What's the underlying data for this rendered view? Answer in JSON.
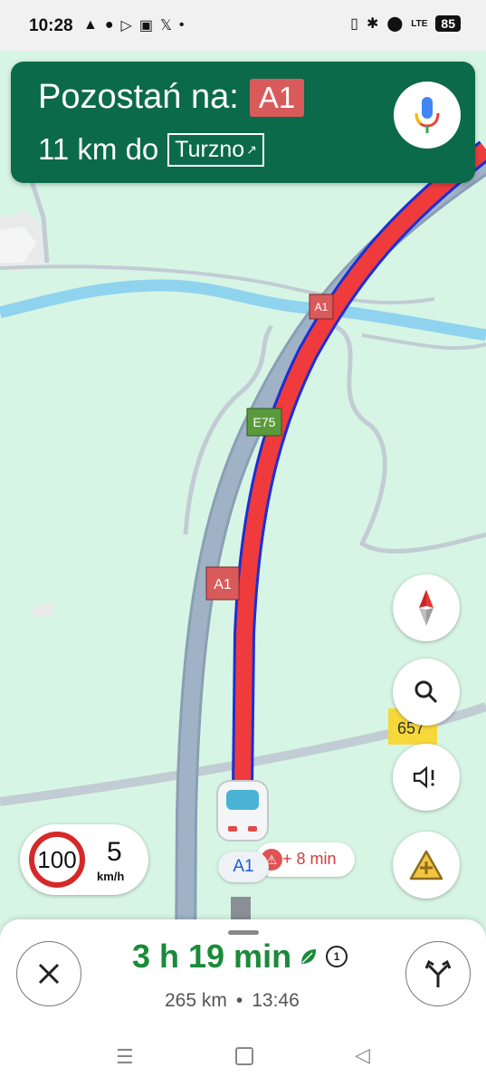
{
  "status_bar": {
    "time": "10:28",
    "battery": "85",
    "left_icons": [
      "navigation-arrow-icon",
      "chat-bubble-icon",
      "play-icon",
      "radio-icon",
      "x-logo-icon",
      "dot-icon"
    ],
    "right_icons": [
      "vibrate-icon",
      "bluetooth-icon",
      "location-pin-icon",
      "lte-signal-icon",
      "battery-icon"
    ],
    "lte_label": "LTE"
  },
  "navigation": {
    "instruction": "Pozostań na:",
    "road": "A1",
    "distance_text": "11 km do",
    "destination": "Turzno",
    "destination_icon": "exit-arrow-icon"
  },
  "map": {
    "road_labels": [
      "A1",
      "E75",
      "A1"
    ],
    "road_657": "657",
    "road_shield_red": "#d95a5a",
    "road_shield_green": "#5a9a3c",
    "route_color": "#ef3b3b",
    "route_outline": "#1a2fd6"
  },
  "speed": {
    "limit": "100",
    "current": "5",
    "unit": "km/h"
  },
  "delay": {
    "text": "+ 8 min"
  },
  "current_road_chip": "A1",
  "trip": {
    "duration": "3 h 19 min",
    "eco_icon": "leaf-icon",
    "toll_badge": "1",
    "distance": "265 km",
    "separator": "•",
    "arrival": "13:46"
  },
  "controls": [
    "compass-icon",
    "search-icon",
    "sound-alert-icon",
    "report-incident-icon"
  ],
  "colors": {
    "banner": "#0b6a4a",
    "eta_green": "#1b8a3a",
    "delay_red": "#d23c3c",
    "map_bg": "#d7f5e4"
  }
}
